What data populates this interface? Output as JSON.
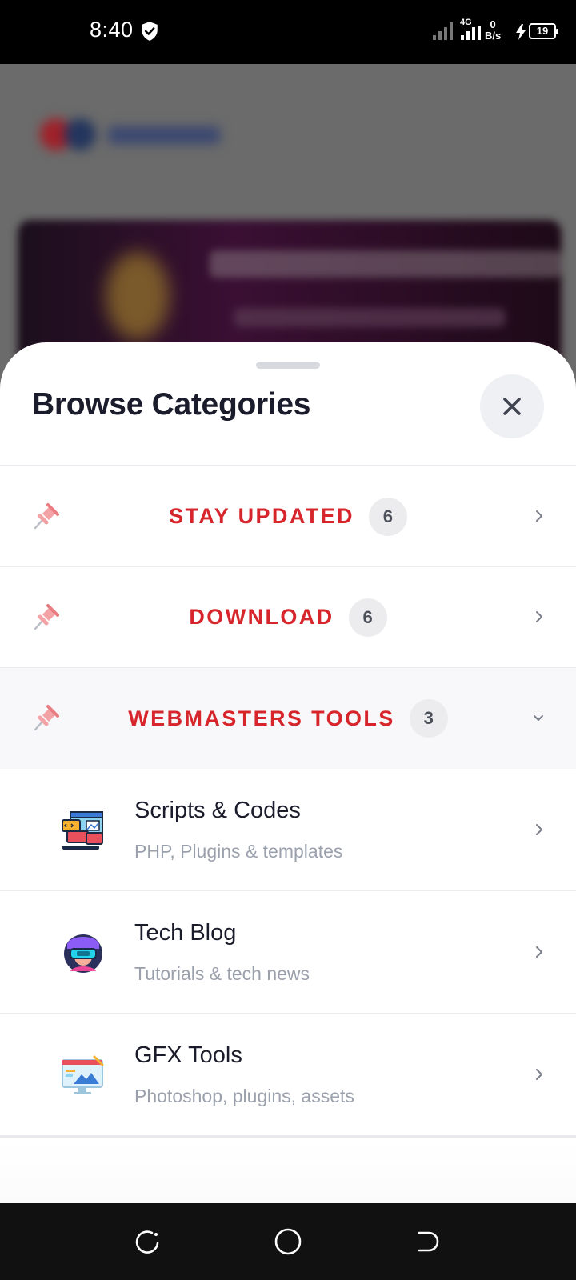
{
  "status_bar": {
    "time": "8:40",
    "network": "4G",
    "speed_value": "0",
    "speed_unit": "B/s",
    "battery": "19",
    "icons": [
      "shield-check-icon",
      "signal-icon",
      "signal-4g-icon",
      "charging-bolt-icon",
      "battery-icon"
    ]
  },
  "sheet": {
    "title": "Browse Categories",
    "close_icon": "close-icon",
    "categories": [
      {
        "label": "STAY UPDATED",
        "count": "6",
        "icon": "pin-icon",
        "state": "collapsed"
      },
      {
        "label": "DOWNLOAD",
        "count": "6",
        "icon": "pin-icon",
        "state": "collapsed"
      },
      {
        "label": "WEBMASTERS TOOLS",
        "count": "3",
        "icon": "pin-icon",
        "state": "expanded"
      }
    ],
    "subcategories": [
      {
        "title": "Scripts & Codes",
        "description": "PHP, Plugins & templates",
        "icon": "code-window-icon"
      },
      {
        "title": "Tech Blog",
        "description": "Tutorials & tech news",
        "icon": "vr-user-icon"
      },
      {
        "title": "GFX Tools",
        "description": "Photoshop, plugins, assets",
        "icon": "design-monitor-icon"
      }
    ]
  },
  "nav_bar": {
    "icons": [
      "recent-apps-icon",
      "home-icon",
      "back-icon"
    ]
  },
  "colors": {
    "accent_red": "#d6262b",
    "title_dark": "#1a1c2b",
    "muted_gray": "#9aa0ac"
  }
}
